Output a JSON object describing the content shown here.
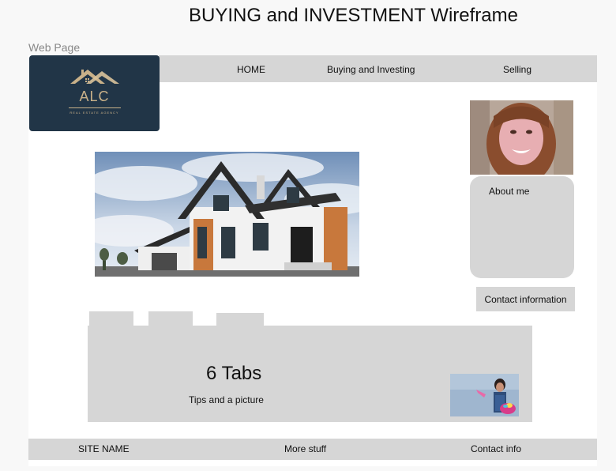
{
  "title": "BUYING and INVESTMENT Wireframe",
  "page_label": "Web Page",
  "nav": {
    "items": [
      "HOME",
      "Buying and Investing",
      "Selling"
    ]
  },
  "logo": {
    "text": "ALC",
    "subtext": "REAL ESTATE AGENCY"
  },
  "about": {
    "label": "About me"
  },
  "contact_button": "Contact information",
  "tabs": {
    "title": "6 Tabs",
    "subtitle": "Tips and a picture"
  },
  "footer": {
    "site_name": "SITE NAME",
    "more": "More stuff",
    "contact": "Contact info"
  }
}
